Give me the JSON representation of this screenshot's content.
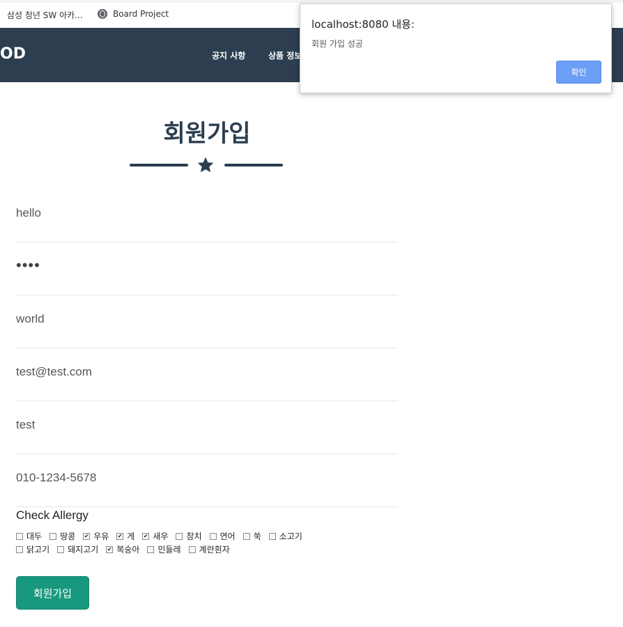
{
  "bookmarks": [
    {
      "label": "삼성 청년 SW 아카..."
    },
    {
      "label": "Board Project"
    }
  ],
  "navbar": {
    "brand": "OD",
    "links": [
      "공지 사항",
      "상품 정보"
    ]
  },
  "page": {
    "title": "회원가입"
  },
  "form": {
    "fields": [
      {
        "value": "hello"
      },
      {
        "value": "••••"
      },
      {
        "value": "world"
      },
      {
        "value": "test@test.com"
      },
      {
        "value": "test"
      },
      {
        "value": "010-1234-5678"
      }
    ],
    "allergy_title": "Check Allergy",
    "allergies_row1": [
      {
        "label": "대두",
        "checked": false
      },
      {
        "label": "땅콩",
        "checked": false
      },
      {
        "label": "우유",
        "checked": true
      },
      {
        "label": "게",
        "checked": true
      },
      {
        "label": "새우",
        "checked": true
      },
      {
        "label": "참치",
        "checked": false
      },
      {
        "label": "연어",
        "checked": false
      },
      {
        "label": "쑥",
        "checked": false
      },
      {
        "label": "소고기",
        "checked": false
      }
    ],
    "allergies_row2": [
      {
        "label": "닭고기",
        "checked": false
      },
      {
        "label": "돼지고기",
        "checked": false
      },
      {
        "label": "복숭아",
        "checked": true
      },
      {
        "label": "민들레",
        "checked": false
      },
      {
        "label": "계란흰자",
        "checked": false
      }
    ],
    "submit_label": "회원가입"
  },
  "dialog": {
    "title": "localhost:8080 내용:",
    "message": "회원 가입 성공",
    "ok_label": "확인"
  },
  "colors": {
    "navbar": "#2c3e50",
    "submit": "#18997f",
    "dialog_button": "#6b9ff5"
  }
}
